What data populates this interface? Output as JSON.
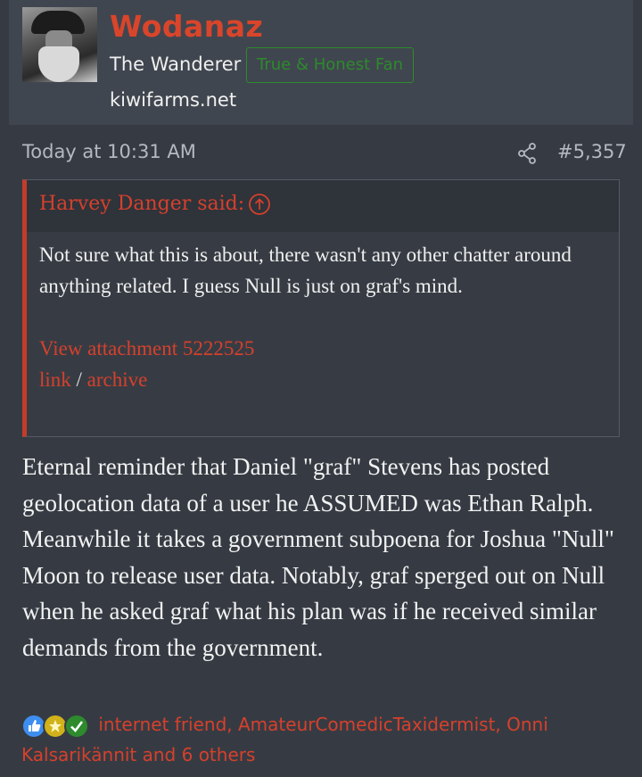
{
  "user": {
    "name": "Wodanaz",
    "title": "The Wanderer",
    "banner": "True & Honest Fan",
    "site": "kiwifarms.net"
  },
  "post": {
    "date": "Today at 10:31 AM",
    "number": "#5,357",
    "body": "Eternal reminder that Daniel \"graf\" Stevens has posted geolocation data of a user he ASSUMED was Ethan Ralph. Meanwhile it takes a government subpoena for Joshua \"Null\" Moon to release user data. Notably, graf sperged out on Null when he asked graf what his plan was if he received similar demands from the government."
  },
  "quote": {
    "author": "Harvey Danger said:",
    "line1": "Not sure what this is about, there wasn't any other chatter around anything related. I guess Null is just on graf's mind.",
    "attachment": "View attachment 5222525",
    "link": "link",
    "separator": "/",
    "archive": "archive"
  },
  "reactions": {
    "text": "internet friend, AmateurComedicTaxidermist, Onni Kalsarikännit and 6 others",
    "icons": [
      "like-icon",
      "medal-icon",
      "check-icon"
    ]
  },
  "colors": {
    "accent": "#d6402c",
    "banner_green": "#2d8a2d",
    "background": "#363b43"
  }
}
